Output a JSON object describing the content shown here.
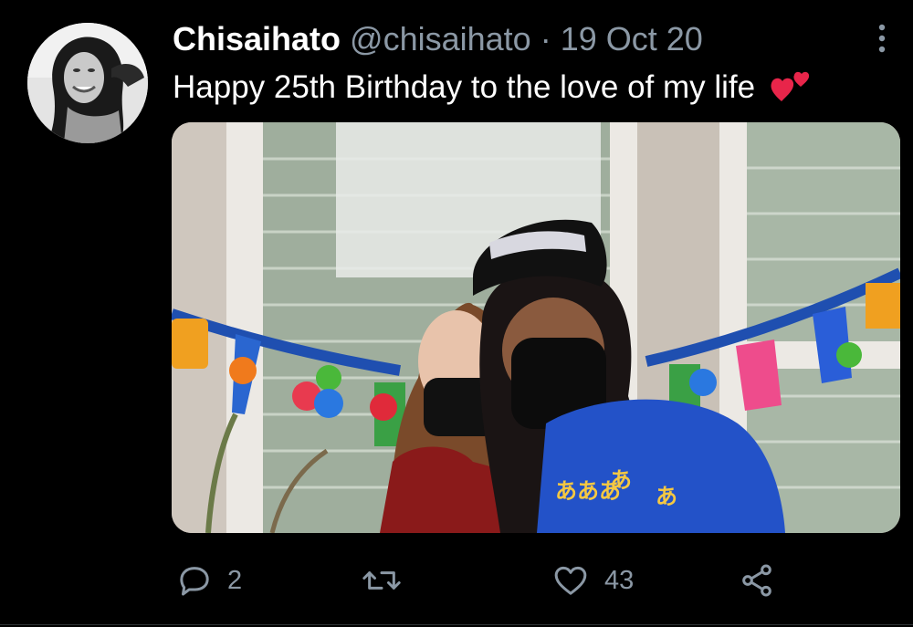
{
  "tweet": {
    "author": {
      "display_name": "Chisaihato",
      "handle": "@chisaihato",
      "avatar_icon": "profile-photo"
    },
    "separator": "·",
    "date": "19 Oct 20",
    "text": "Happy 25th Birthday to the love of my life",
    "emoji": "two-hearts-emoji",
    "media": {
      "type": "photo",
      "icon": "birthday-photo"
    },
    "actions": {
      "reply": {
        "icon": "reply-icon",
        "count": "2"
      },
      "retweet": {
        "icon": "retweet-icon",
        "count": ""
      },
      "like": {
        "icon": "heart-icon",
        "count": "43"
      },
      "share": {
        "icon": "share-icon"
      }
    },
    "more_icon": "more-vertical-icon"
  },
  "colors": {
    "background": "#000000",
    "text_primary": "#ffffff",
    "text_secondary": "#8b98a5",
    "heart_emoji": "#e8254a",
    "divider": "#2f3336"
  }
}
